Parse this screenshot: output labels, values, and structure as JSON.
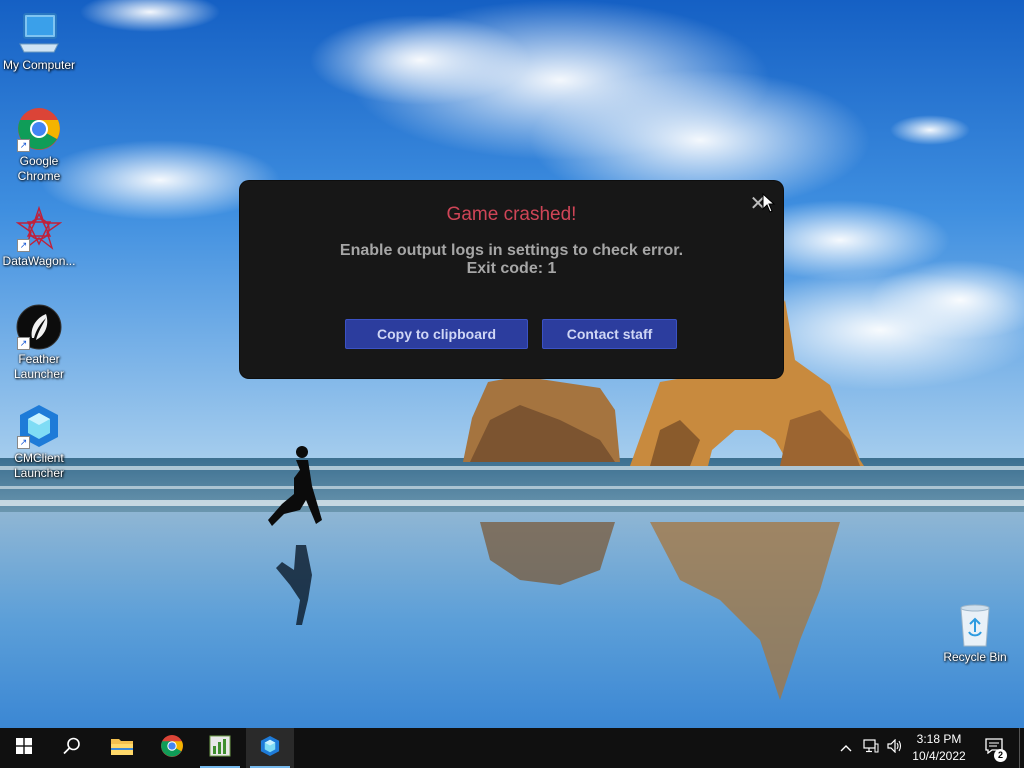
{
  "desktop": {
    "icons": [
      {
        "label": "My Computer",
        "icon": "computer-icon"
      },
      {
        "label": "Google Chrome",
        "icon": "chrome-icon"
      },
      {
        "label": "DataWagon...",
        "icon": "datawagon-icon"
      },
      {
        "label": "Feather Launcher",
        "icon": "feather-icon"
      },
      {
        "label": "CMClient Launcher",
        "icon": "cmclient-icon"
      },
      {
        "label": "Recycle Bin",
        "icon": "recycle-bin-icon"
      }
    ]
  },
  "dialog": {
    "title": "Game crashed!",
    "message_line1": "Enable output logs in settings to check error.",
    "message_line2": "Exit code: 1",
    "close_label": "✕",
    "copy_label": "Copy to clipboard",
    "contact_label": "Contact staff",
    "title_color": "#cf4557",
    "button_color": "#2c3d9e"
  },
  "taskbar": {
    "items": [
      "start-icon",
      "search-icon",
      "file-explorer-icon",
      "chrome-icon",
      "notepad-icon",
      "cmclient-icon"
    ],
    "time": "3:18 PM",
    "date": "10/4/2022",
    "notification_count": "2",
    "accent": "#76b9ed"
  }
}
